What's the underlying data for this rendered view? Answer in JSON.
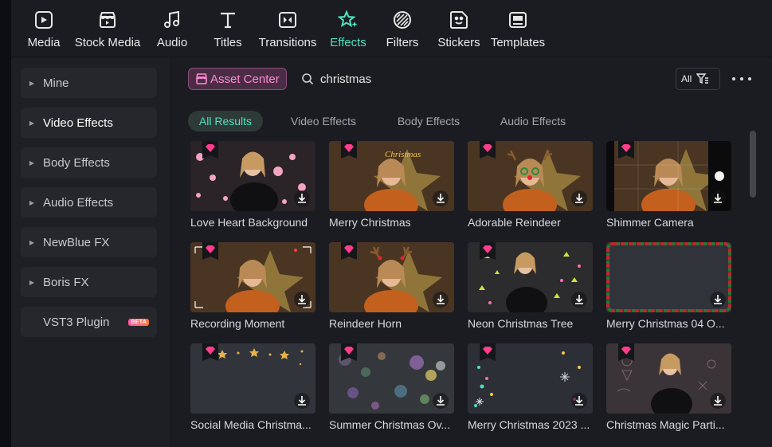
{
  "toolbar": {
    "items": [
      {
        "label": "Media",
        "icon": "media-icon"
      },
      {
        "label": "Stock Media",
        "icon": "stock-media-icon"
      },
      {
        "label": "Audio",
        "icon": "music-note-icon"
      },
      {
        "label": "Titles",
        "icon": "title-t-icon"
      },
      {
        "label": "Transitions",
        "icon": "transition-icon"
      },
      {
        "label": "Effects",
        "icon": "effects-star-icon",
        "active": true
      },
      {
        "label": "Filters",
        "icon": "filter-icon"
      },
      {
        "label": "Stickers",
        "icon": "sticker-icon"
      },
      {
        "label": "Templates",
        "icon": "template-icon"
      }
    ]
  },
  "sidebar": {
    "items": [
      {
        "label": "Mine"
      },
      {
        "label": "Video Effects",
        "active": true
      },
      {
        "label": "Body Effects"
      },
      {
        "label": "Audio Effects"
      },
      {
        "label": "NewBlue FX"
      },
      {
        "label": "Boris FX"
      },
      {
        "label": "VST3 Plugin",
        "badge": "BETA"
      }
    ]
  },
  "main": {
    "asset_center_label": "Asset Center",
    "search": {
      "value": "christmas"
    },
    "filter_label": "All",
    "tabs": [
      {
        "label": "All Results",
        "active": true
      },
      {
        "label": "Video Effects"
      },
      {
        "label": "Body Effects"
      },
      {
        "label": "Audio Effects"
      }
    ],
    "results": [
      {
        "title": "Love Heart Background"
      },
      {
        "title": "Merry Christmas"
      },
      {
        "title": "Adorable Reindeer"
      },
      {
        "title": "Shimmer Camera"
      },
      {
        "title": "Recording Moment"
      },
      {
        "title": "Reindeer Horn"
      },
      {
        "title": "Neon Christmas Tree"
      },
      {
        "title": "Merry Christmas 04 O..."
      },
      {
        "title": "Social Media Christma..."
      },
      {
        "title": "Summer Christmas Ov..."
      },
      {
        "title": "Merry Christmas 2023 ..."
      },
      {
        "title": "Christmas Magic Parti..."
      }
    ]
  },
  "colors": {
    "accent": "#4fe3c1",
    "asset_pink": "#ff8ad4",
    "gem": "#ff3d8b"
  }
}
